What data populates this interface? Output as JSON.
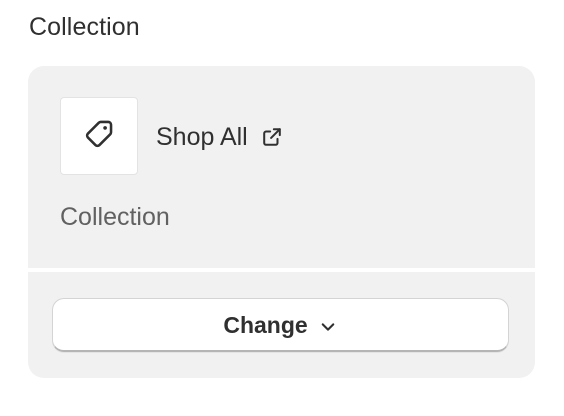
{
  "section": {
    "label": "Collection"
  },
  "resource": {
    "icon": "tag-icon",
    "title": "Shop All",
    "link_icon": "external-link-icon",
    "type_label": "Collection"
  },
  "actions": {
    "change_label": "Change",
    "change_icon": "chevron-down-icon"
  },
  "colors": {
    "card_background": "#f1f1f1",
    "text_primary": "#303030",
    "text_secondary": "#616161"
  }
}
